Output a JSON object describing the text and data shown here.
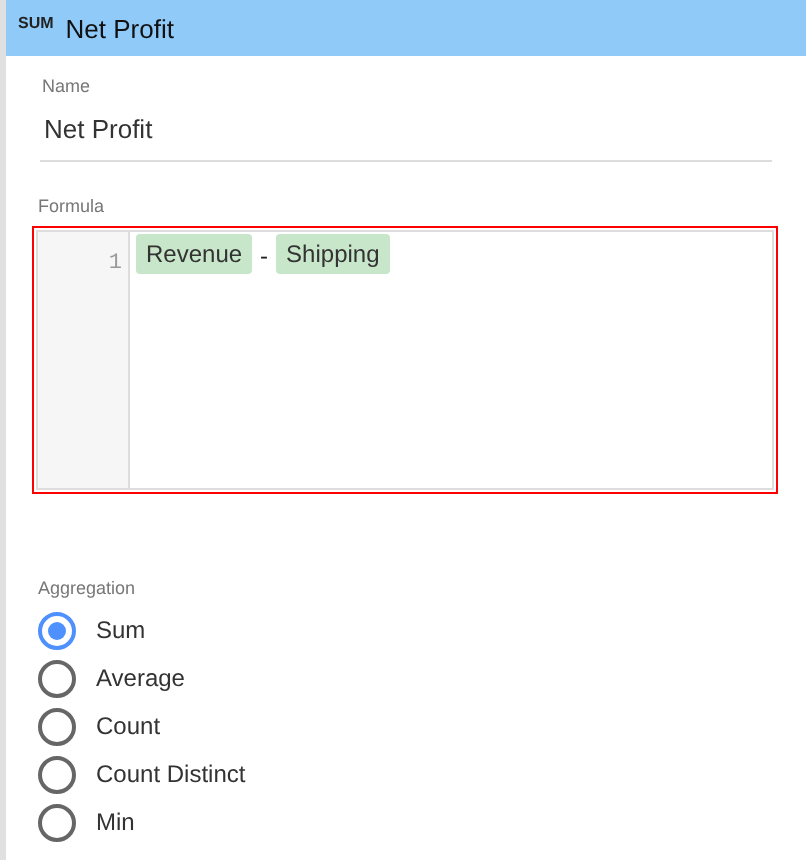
{
  "header": {
    "badge": "SUM",
    "title": "Net Profit"
  },
  "name_field": {
    "label": "Name",
    "value": "Net Profit"
  },
  "formula": {
    "label": "Formula",
    "line_number": "1",
    "has_error": true,
    "tokens": [
      {
        "kind": "field",
        "text": "Revenue"
      },
      {
        "kind": "operator",
        "text": "-"
      },
      {
        "kind": "field",
        "text": "Shipping"
      }
    ]
  },
  "aggregation": {
    "label": "Aggregation",
    "options": [
      {
        "label": "Sum",
        "selected": true
      },
      {
        "label": "Average",
        "selected": false
      },
      {
        "label": "Count",
        "selected": false
      },
      {
        "label": "Count Distinct",
        "selected": false
      },
      {
        "label": "Min",
        "selected": false
      }
    ]
  }
}
